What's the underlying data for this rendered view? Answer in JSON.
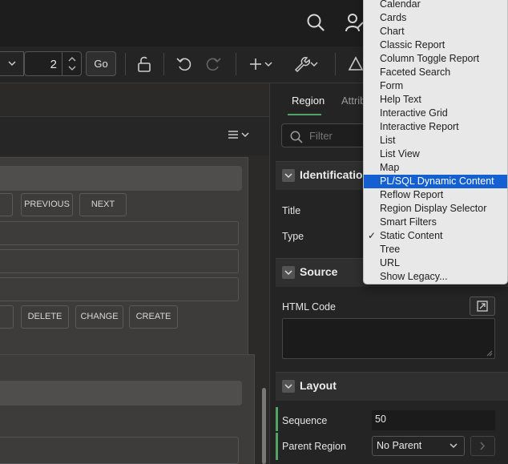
{
  "toolbar": {
    "page_number": "2",
    "go_label": "Go"
  },
  "canvas": {
    "buttons_row1": [
      "PREVIOUS",
      "NEXT"
    ],
    "buttons_row2": [
      "DELETE",
      "CHANGE",
      "CREATE"
    ]
  },
  "panel": {
    "tabs": {
      "region": "Region",
      "attributes": "Attrib"
    },
    "filter_placeholder": "Filter",
    "sections": {
      "identification": "Identification",
      "source": "Source",
      "layout": "Layout"
    },
    "labels": {
      "title": "Title",
      "type": "Type",
      "html_code": "HTML Code",
      "sequence": "Sequence",
      "parent_region": "Parent Region"
    },
    "values": {
      "sequence": "50",
      "parent_region": "No Parent"
    }
  },
  "dropdown": {
    "items": [
      "Calendar",
      "Cards",
      "Chart",
      "Classic Report",
      "Column Toggle Report",
      "Faceted Search",
      "Form",
      "Help Text",
      "Interactive Grid",
      "Interactive Report",
      "List",
      "List View",
      "Map",
      "PL/SQL Dynamic Content",
      "Reflow Report",
      "Region Display Selector",
      "Smart Filters",
      "Static Content",
      "Tree",
      "URL",
      "Show Legacy..."
    ],
    "highlighted": "PL/SQL Dynamic Content",
    "checked": "Static Content",
    "check_mark": "✓"
  },
  "colors": {
    "accent_green": "#52a466",
    "highlight_blue": "#1460d2"
  }
}
